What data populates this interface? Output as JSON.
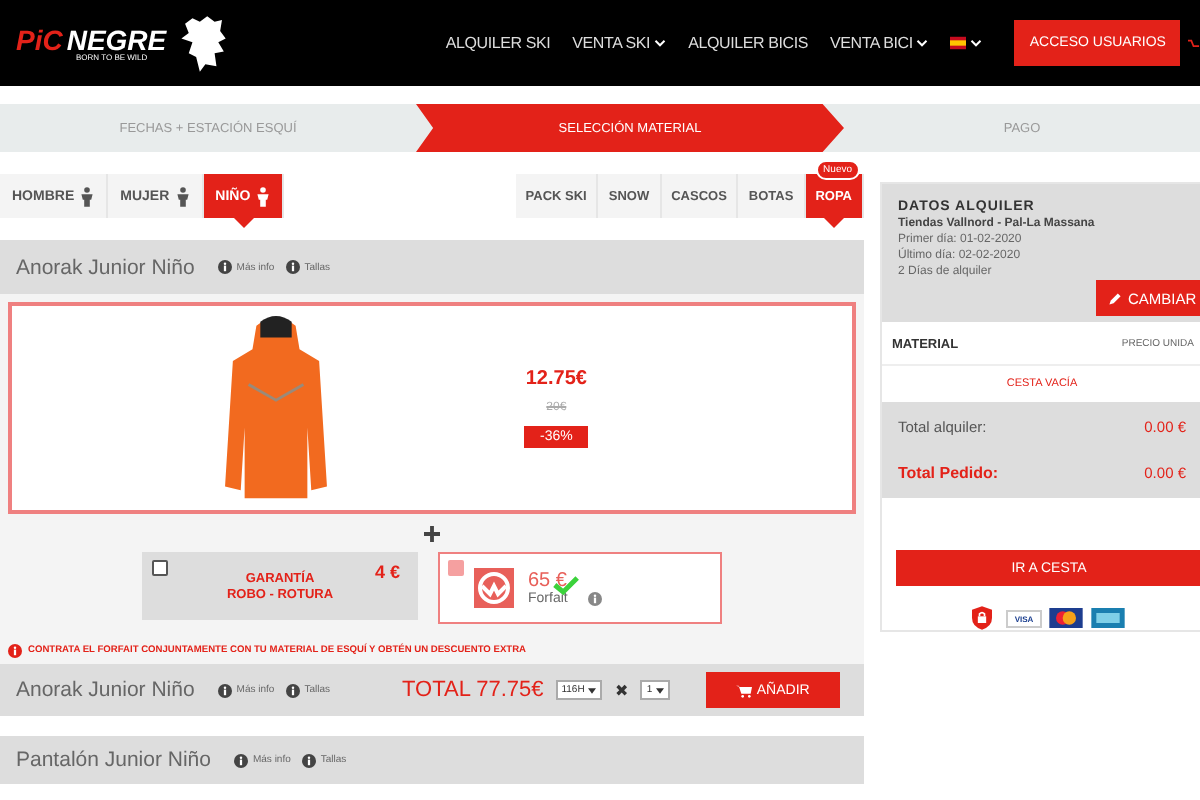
{
  "header": {
    "logo": {
      "part_1": "PiC",
      "part_2": "NEGRE",
      "tagline": "BORN TO BE WILD"
    },
    "nav": [
      {
        "label": "ALQUILER SKI",
        "dropdown": false
      },
      {
        "label": "VENTA SKI",
        "dropdown": true
      },
      {
        "label": "ALQUILER BICIS",
        "dropdown": false
      },
      {
        "label": "VENTA BICI",
        "dropdown": true
      }
    ],
    "login_button": "ACCESO USUARIOS"
  },
  "steps": [
    {
      "label": "FECHAS + ESTACIÓN ESQUÍ",
      "selected": false
    },
    {
      "label": "SELECCIÓN MATERIAL",
      "selected": true
    },
    {
      "label": "PAGO",
      "selected": false
    }
  ],
  "gender_tabs": [
    {
      "label": "HOMBRE",
      "selected": false
    },
    {
      "label": "MUJER",
      "selected": false
    },
    {
      "label": "NIÑO",
      "selected": true
    }
  ],
  "category_tabs": [
    {
      "label": "PACK SKI",
      "selected": false
    },
    {
      "label": "SNOW",
      "selected": false
    },
    {
      "label": "CASCOS",
      "selected": false
    },
    {
      "label": "BOTAS",
      "selected": false
    },
    {
      "label": "ROPA",
      "selected": true,
      "badge": "Nuevo"
    }
  ],
  "product": {
    "title": "Anorak Junior Niño",
    "links": [
      "Más info",
      "Tallas"
    ],
    "price": "12.75€",
    "old_price": "20€",
    "discount": "-36%",
    "extras": [
      {
        "kind": "insurance",
        "checked": false,
        "lines": [
          "GARANTÍA",
          "ROBO - ROTURA"
        ],
        "price": "4 €"
      },
      {
        "kind": "forfait",
        "checked": true,
        "price": "65 €",
        "label": "Forfait"
      }
    ],
    "notice": "CONTRATA EL FORFAIT CONJUNTAMENTE CON TU MATERIAL DE ESQUÍ Y OBTÉN UN DESCUENTO EXTRA",
    "footer": {
      "title": "Anorak Junior Niño",
      "links": [
        "Más info",
        "Tallas"
      ],
      "total": "TOTAL 77.75€",
      "size": "116H",
      "times": "✖",
      "quantity": "1",
      "add_button": "AÑADIR"
    }
  },
  "next_product": {
    "title": "Pantalón Junior Niño",
    "links": [
      "Más info",
      "Tallas"
    ]
  },
  "sidebar": {
    "title": "DATOS ALQUILER",
    "shop": "Tiendas Vallnord - Pal-La Massana",
    "first_day": "Primer día: 01-02-2020",
    "last_day": "Último día: 02-02-2020",
    "days": "2 Días de alquiler",
    "change_button": "CAMBIAR",
    "columns": [
      "MATERIAL",
      "PRECIO UNIDA"
    ],
    "empty": "CESTA VACÍA",
    "totals": [
      {
        "label": "Total alquiler:",
        "value": "0.00 €",
        "kind": "rental"
      },
      {
        "label": "Total Pedido:",
        "value": "0.00 €",
        "kind": "order"
      }
    ],
    "checkout_button": "IR A CESTA",
    "visa_label": "VISA"
  }
}
